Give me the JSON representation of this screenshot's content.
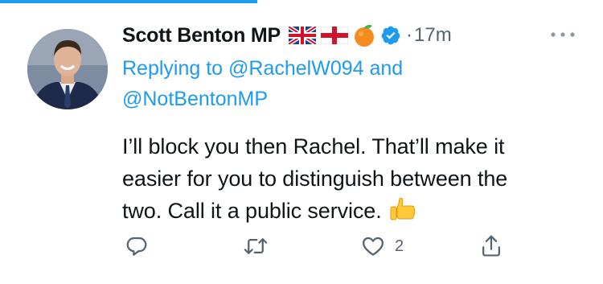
{
  "tweet": {
    "display_name": "Scott Benton MP",
    "name_emojis": [
      "uk-flag-icon",
      "england-flag-icon",
      "orange-icon"
    ],
    "verified": true,
    "dot": "·",
    "timestamp": "17m",
    "reply_prefix": "Replying to",
    "reply_mention_1": "@RachelW094",
    "reply_and": "and",
    "reply_mention_2": "@NotBentonMP",
    "text_line_1": "I’ll block you then Rachel. That’ll make it",
    "text_line_2": "easier for you to distinguish between the",
    "text_line_3": "two. Call it a public service.",
    "text_emoji": "thumbs-up-icon"
  },
  "actions": {
    "reply": {
      "icon": "reply-icon",
      "count": ""
    },
    "retweet": {
      "icon": "retweet-icon",
      "count": ""
    },
    "like": {
      "icon": "heart-icon",
      "count": "2"
    },
    "share": {
      "icon": "share-icon",
      "count": ""
    }
  },
  "colors": {
    "accent": "#1d9bf0",
    "text": "#0f1419",
    "muted": "#536471"
  }
}
